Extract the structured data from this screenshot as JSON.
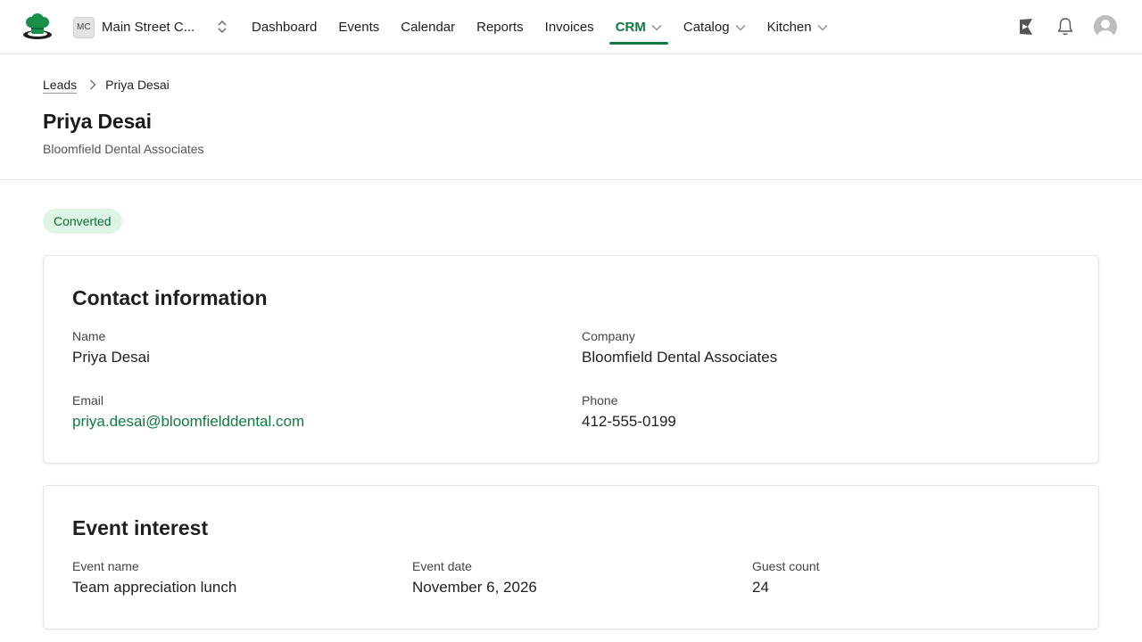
{
  "org": {
    "initials": "MC",
    "name": "Main Street C..."
  },
  "nav": {
    "items": [
      {
        "label": "Dashboard",
        "active": false,
        "dropdown": false
      },
      {
        "label": "Events",
        "active": false,
        "dropdown": false
      },
      {
        "label": "Calendar",
        "active": false,
        "dropdown": false
      },
      {
        "label": "Reports",
        "active": false,
        "dropdown": false
      },
      {
        "label": "Invoices",
        "active": false,
        "dropdown": false
      },
      {
        "label": "CRM",
        "active": true,
        "dropdown": true
      },
      {
        "label": "Catalog",
        "active": false,
        "dropdown": true
      },
      {
        "label": "Kitchen",
        "active": false,
        "dropdown": true
      }
    ]
  },
  "icons": {
    "logo": "chef-hat-logo-icon",
    "org_switch": "chevron-up-down-icon",
    "announcements": "megaphone-icon",
    "notifications": "bell-icon",
    "profile": "user-avatar-icon",
    "breadcrumb_sep": "chevron-right-icon"
  },
  "colors": {
    "accent": "#0f7a3e",
    "badge_bg": "#dcf5e4",
    "badge_text": "#0f6b38"
  },
  "breadcrumb": {
    "parent": "Leads",
    "current": "Priya Desai"
  },
  "header": {
    "title": "Priya Desai",
    "subtitle": "Bloomfield Dental Associates"
  },
  "status": {
    "label": "Converted"
  },
  "contact": {
    "title": "Contact information",
    "name_label": "Name",
    "name_value": "Priya Desai",
    "company_label": "Company",
    "company_value": "Bloomfield Dental Associates",
    "email_label": "Email",
    "email_value": "priya.desai@bloomfielddental.com",
    "phone_label": "Phone",
    "phone_value": "412-555-0199"
  },
  "event": {
    "title": "Event interest",
    "name_label": "Event name",
    "name_value": "Team appreciation lunch",
    "date_label": "Event date",
    "date_value": "November 6, 2026",
    "guests_label": "Guest count",
    "guests_value": "24"
  }
}
